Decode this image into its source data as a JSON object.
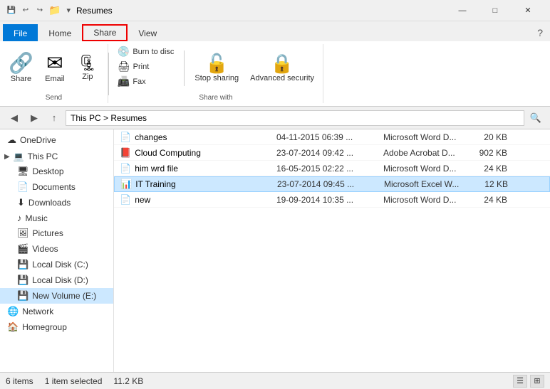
{
  "titleBar": {
    "title": "Resumes",
    "backIcon": "◀",
    "forwardIcon": "▶",
    "upIcon": "↑",
    "folderIcon": "📁",
    "minimize": "—",
    "maximize": "□",
    "close": "✕"
  },
  "ribbonTabs": {
    "file": "File",
    "home": "Home",
    "share": "Share",
    "view": "View",
    "help": "?"
  },
  "ribbon": {
    "sendGroup": {
      "label": "Send",
      "shareBtn": {
        "icon": "🔗",
        "label": "Share"
      },
      "emailBtn": {
        "icon": "✉",
        "label": "Email"
      },
      "zipBtn": {
        "icon": "🗜",
        "label": "Zip"
      }
    },
    "shareWithGroup": {
      "label": "Share with",
      "burnBtn": "Burn to disc",
      "printBtn": "Print",
      "faxBtn": "Fax",
      "stopSharingBtn": {
        "icon": "🔒",
        "label": "Stop sharing"
      },
      "advancedBtn": {
        "icon": "🔒",
        "label": "Advanced security"
      }
    }
  },
  "addressBar": {
    "path": "This PC > Resumes"
  },
  "sidebar": {
    "items": [
      {
        "id": "onedrive",
        "label": "OneDrive",
        "icon": "☁",
        "indent": 0
      },
      {
        "id": "this-pc",
        "label": "This PC",
        "icon": "💻",
        "indent": 0
      },
      {
        "id": "desktop",
        "label": "Desktop",
        "icon": "🖥",
        "indent": 1
      },
      {
        "id": "documents",
        "label": "Documents",
        "icon": "📄",
        "indent": 1
      },
      {
        "id": "downloads",
        "label": "Downloads",
        "icon": "⬇",
        "indent": 1
      },
      {
        "id": "music",
        "label": "Music",
        "icon": "♪",
        "indent": 1
      },
      {
        "id": "pictures",
        "label": "Pictures",
        "icon": "🖼",
        "indent": 1
      },
      {
        "id": "videos",
        "label": "Videos",
        "icon": "🎬",
        "indent": 1
      },
      {
        "id": "local-c",
        "label": "Local Disk (C:)",
        "icon": "💾",
        "indent": 1
      },
      {
        "id": "local-d",
        "label": "Local Disk (D:)",
        "icon": "💾",
        "indent": 1
      },
      {
        "id": "new-vol-e",
        "label": "New Volume (E:)",
        "icon": "💾",
        "indent": 1,
        "selected": true
      },
      {
        "id": "network",
        "label": "Network",
        "icon": "🌐",
        "indent": 0
      },
      {
        "id": "homegroup",
        "label": "Homegroup",
        "icon": "🏠",
        "indent": 0
      }
    ]
  },
  "fileList": {
    "columns": [
      "Name",
      "Date modified",
      "Type",
      "Size"
    ],
    "files": [
      {
        "id": "changes",
        "name": "changes",
        "icon": "📄",
        "iconColor": "#2b5fb5",
        "date": "04-11-2015 06:39 ...",
        "type": "Microsoft Word D...",
        "size": "20 KB",
        "selected": false
      },
      {
        "id": "cloud-computing",
        "name": "Cloud Computing",
        "icon": "📕",
        "iconColor": "#c00",
        "date": "23-07-2014 09:42 ...",
        "type": "Adobe Acrobat D...",
        "size": "902 KB",
        "selected": false
      },
      {
        "id": "him-wrd",
        "name": "him wrd file",
        "icon": "📄",
        "iconColor": "#2b5fb5",
        "date": "16-05-2015 02:22 ...",
        "type": "Microsoft Word D...",
        "size": "24 KB",
        "selected": false
      },
      {
        "id": "it-training",
        "name": "IT Training",
        "icon": "📊",
        "iconColor": "#1f7c42",
        "date": "23-07-2014 09:45 ...",
        "type": "Microsoft Excel W...",
        "size": "12 KB",
        "selected": true
      },
      {
        "id": "new",
        "name": "new",
        "icon": "📄",
        "iconColor": "#2b5fb5",
        "date": "19-09-2014 10:35 ...",
        "type": "Microsoft Word D...",
        "size": "24 KB",
        "selected": false
      }
    ]
  },
  "statusBar": {
    "itemCount": "6 items",
    "selected": "1 item selected",
    "size": "11.2 KB",
    "listViewIcon": "☰",
    "detailViewIcon": "⊞"
  }
}
